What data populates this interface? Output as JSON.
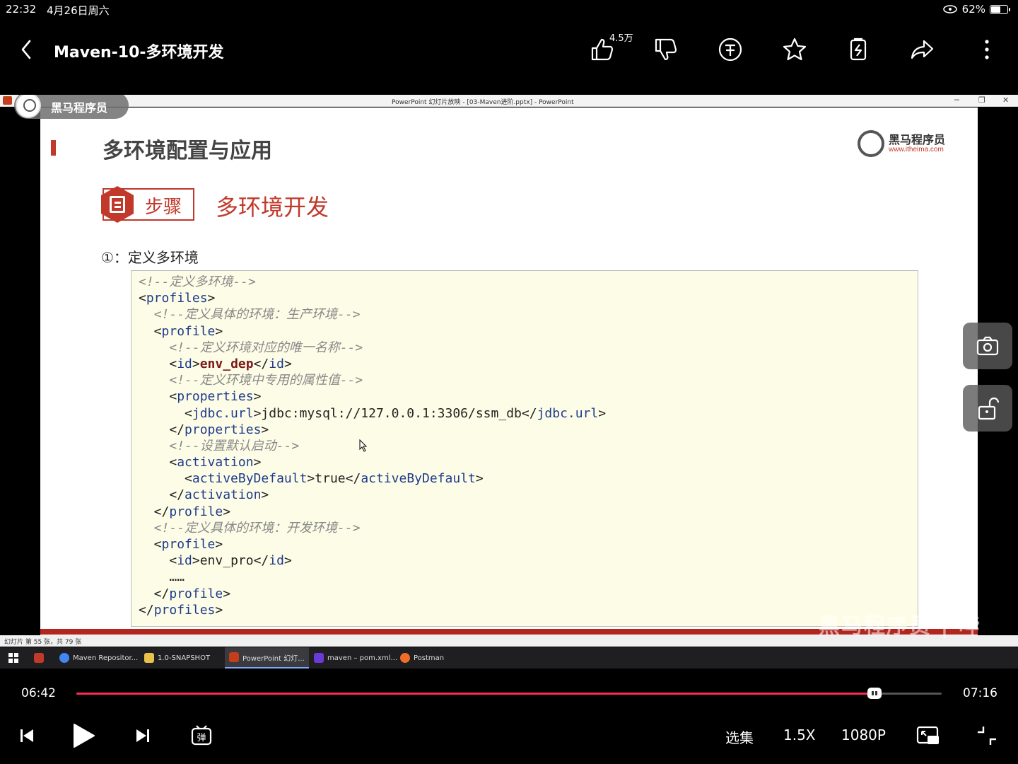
{
  "status_bar": {
    "time": "22:32",
    "date": "4月26日周六",
    "battery": "62%",
    "battery_level": 0.62
  },
  "header": {
    "title": "Maven-10-多环境开发",
    "like_count": "4.5万"
  },
  "ppt": {
    "window_title": "PowerPoint 幻灯片放映 - [03-Maven进阶.pptx] - PowerPoint",
    "logo_label": "黑马程序员",
    "brand_name": "黑马程序员",
    "brand_url": "www.itheima.com",
    "slide_title": "多环境配置与应用",
    "step_label": "步骤",
    "step_title": "多环境开发",
    "sub_heading": "①：定义多环境",
    "status_text": "幻灯片 第 55 张，共 79 张",
    "watermark": "黑马程序员 | 哔"
  },
  "code": {
    "l1": "<!--定义多环境-->",
    "l2_tag": "profiles",
    "l3": "<!--定义具体的环境：生产环境-->",
    "l4_tag": "profile",
    "l5": "<!--定义环境对应的唯一名称-->",
    "l6_tag": "id",
    "l6_val": "env_dep",
    "l7": "<!--定义环境中专用的属性值-->",
    "l8_tag": "properties",
    "l9_tag": "jdbc.url",
    "l9_val": "jdbc:mysql://127.0.0.1:3306/ssm_db",
    "l11": "<!--设置默认启动-->",
    "l12_tag": "activation",
    "l13_tag": "activeByDefault",
    "l13_val": "true",
    "l16": "<!--定义具体的环境：开发环境-->",
    "l18_val": "env_pro",
    "l19": "……"
  },
  "taskbar": {
    "items": [
      "Maven Repositor...",
      "1.0-SNAPSHOT",
      "PowerPoint 幻灯...",
      "maven – pom.xml...",
      "Postman"
    ]
  },
  "player": {
    "current_time": "06:42",
    "total_time": "07:16",
    "progress": 0.922,
    "episodes": "选集",
    "speed": "1.5X",
    "quality": "1080P"
  },
  "colors": {
    "accent_red": "#c0392b",
    "progress": "#fb2d55",
    "code_bg": "#fdfde7"
  }
}
